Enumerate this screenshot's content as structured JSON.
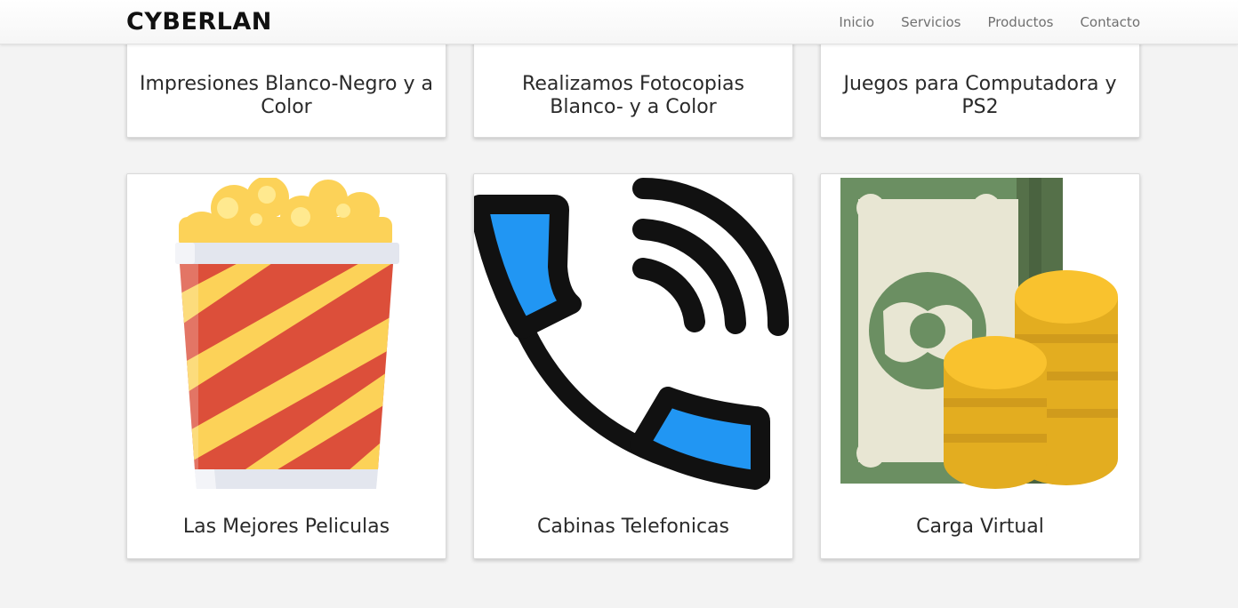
{
  "header": {
    "brand": "CYBERLAN",
    "nav": [
      {
        "label": "Inicio"
      },
      {
        "label": "Servicios"
      },
      {
        "label": "Productos"
      },
      {
        "label": "Contacto"
      }
    ]
  },
  "services_top": [
    {
      "title": "Impresiones Blanco-Negro y a Color"
    },
    {
      "title": "Realizamos Fotocopias Blanco- y a Color"
    },
    {
      "title": "Juegos para Computadora y PS2"
    }
  ],
  "services_bottom": [
    {
      "title": "Las Mejores Peliculas",
      "icon": "popcorn-icon"
    },
    {
      "title": "Cabinas Telefonicas",
      "icon": "phone-call-icon"
    },
    {
      "title": "Carga Virtual",
      "icon": "money-coins-icon"
    }
  ],
  "colors": {
    "background": "#f3f3f3",
    "card": "#ffffff",
    "popcorn_red": "#dc4f3a",
    "popcorn_yellow": "#fcd258",
    "phone_blue": "#2196f3",
    "bill_green": "#6b8f62",
    "coin_gold": "#f9c22e"
  }
}
